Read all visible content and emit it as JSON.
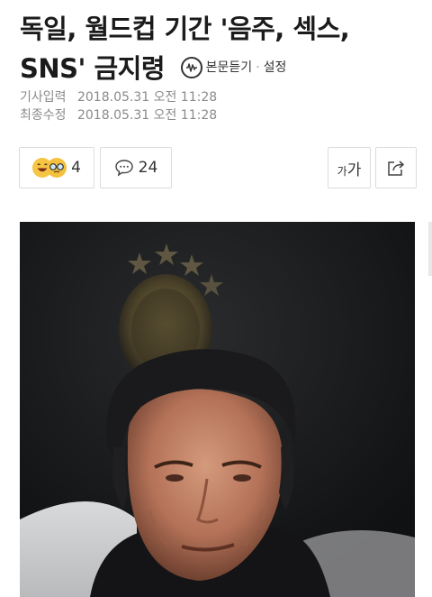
{
  "article": {
    "headline_line1": "독일, 월드컵 기간 '음주, 섹스,",
    "headline_line2": "SNS' 금지령",
    "listen_label": "본문듣기",
    "separator": "·",
    "settings_label": "설정",
    "published_label": "기사입력",
    "published_value": "2018.05.31 오전 11:28",
    "modified_label": "최종수정",
    "modified_value": "2018.05.31 오전 11:28"
  },
  "actions": {
    "reaction_count": "4",
    "comment_count": "24",
    "fontsize_small": "가",
    "fontsize_large": "가"
  },
  "icons": {
    "listen": "speaker-wave-icon",
    "reaction1": "laughing-emoji-icon",
    "reaction2": "glasses-emoji-icon",
    "comment": "speech-bubble-icon",
    "share": "share-arrow-icon"
  },
  "colors": {
    "text": "#1b1b1b",
    "meta": "#8a8a8a",
    "emoji": "#f6c543",
    "border": "#dcdcdc"
  }
}
